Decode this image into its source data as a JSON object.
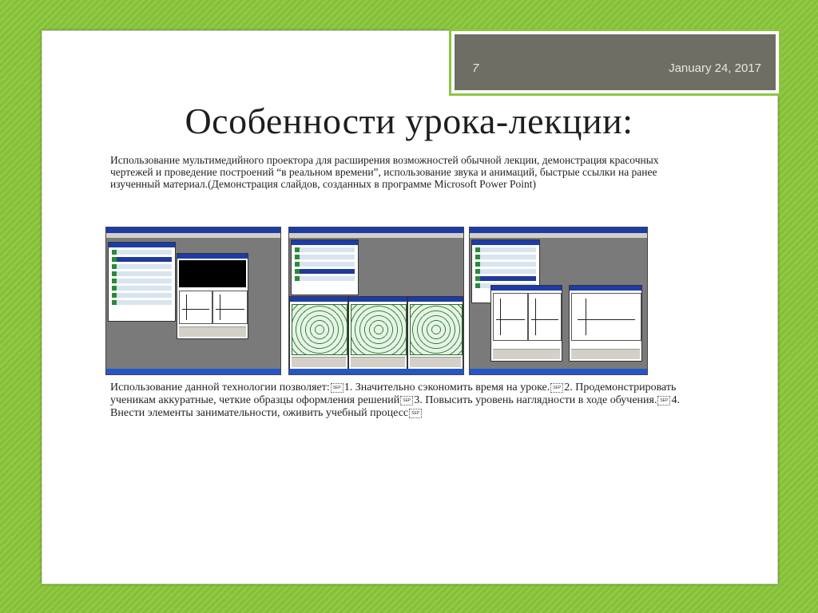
{
  "header": {
    "slide_number": "7",
    "date": "January 24, 2017"
  },
  "title": "Особенности урока-лекции:",
  "intro_text": "Использование мультимедийного проектора для расширения возможностей обычной лекции, демонстрация красочных чертежей и проведение построений “в реальном времени”, использование звука и анимаций, быстрые ссылки на ранее изученный материал.(Демонстрация слайдов, созданных в программе Microsoft Power Point)",
  "outro": {
    "lead": "Использование данной технологии позволяет:",
    "point_1": "1. Значительно сэкономить время на уроке.",
    "point_2": "2. Продемонстрировать ученикам аккуратные, четкие образцы оформления решений",
    "point_3": "3. Повысить уровень наглядности в ходе обучения.",
    "point_4": "4. Внести элементы занимательности, оживить учебный процесс",
    "sep_glyph": "SEP"
  },
  "colors": {
    "background": "#8cc63f",
    "header_box": "#6e6e65",
    "window_title": "#1c3ca8"
  }
}
